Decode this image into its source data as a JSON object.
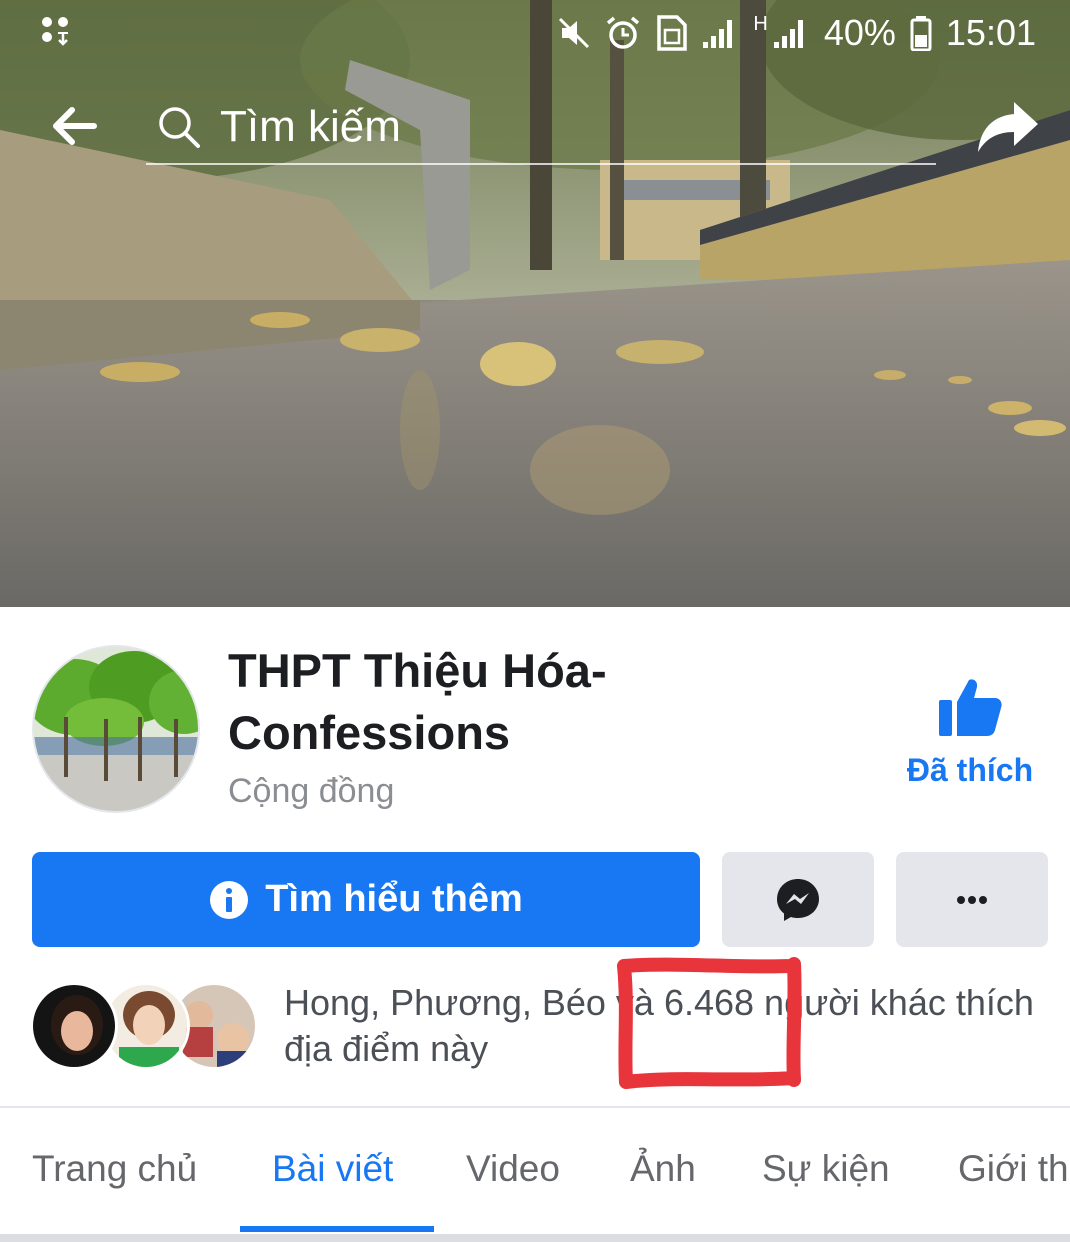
{
  "status_bar": {
    "battery": "40%",
    "time": "15:01",
    "network_label": "H"
  },
  "search": {
    "placeholder": "Tìm kiếm"
  },
  "page": {
    "title": "THPT Thiệu Hóa-Confessions",
    "category": "Cộng đồng",
    "liked_label": "Đã thích"
  },
  "actions": {
    "learn_more_label": "Tìm hiểu thêm"
  },
  "likes": {
    "names": "Hong, Phương, Béo",
    "connector": " và ",
    "count": "6.468",
    "suffix": " người khác thích địa điểm này"
  },
  "tabs": [
    {
      "label": "Trang chủ"
    },
    {
      "label": "Bài viết"
    },
    {
      "label": "Video"
    },
    {
      "label": "Ảnh"
    },
    {
      "label": "Sự kiện"
    },
    {
      "label": "Giới th"
    }
  ],
  "active_tab_index": 1,
  "colors": {
    "accent": "#1877f2",
    "annotation": "#e8343b",
    "button_gray": "#e4e6eb"
  },
  "icons": {
    "back": "arrow-left-icon",
    "search": "search-icon",
    "share": "share-arrow-icon",
    "like": "thumbs-up-icon",
    "info": "info-icon",
    "messenger": "messenger-icon",
    "more": "more-dots-icon"
  }
}
